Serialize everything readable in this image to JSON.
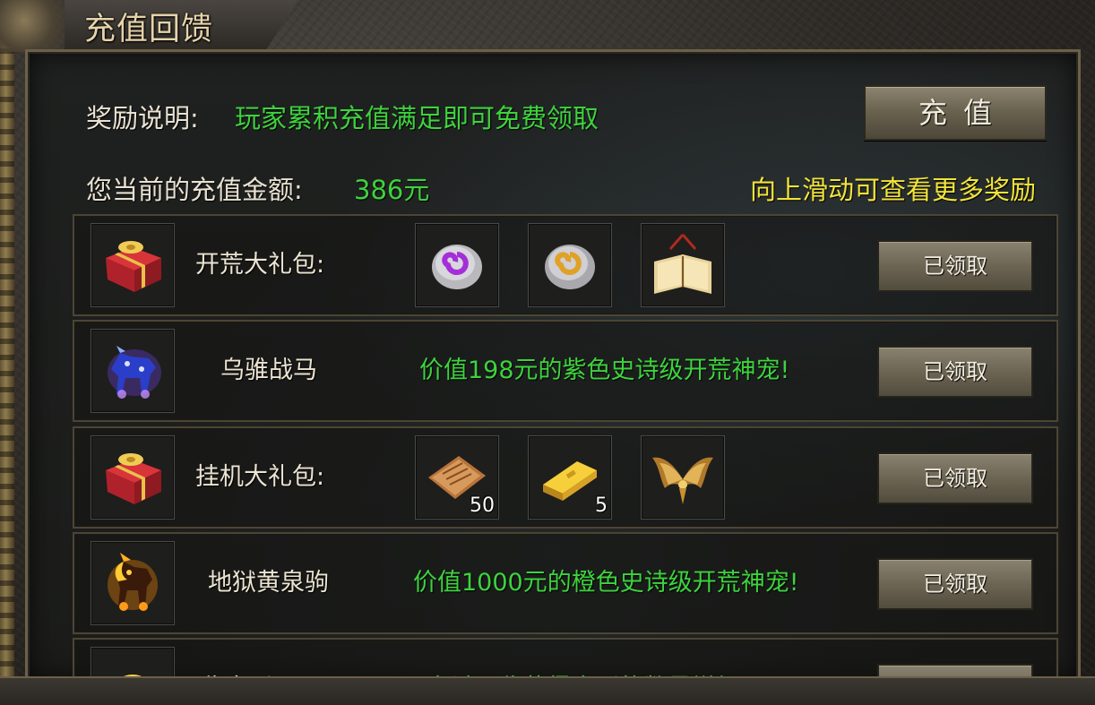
{
  "title": "充值回馈",
  "reward_desc": {
    "label": "奖励说明:",
    "text": "玩家累积充值满足即可免费领取"
  },
  "recharge_button": "充值",
  "current_amount": {
    "label": "您当前的充值金额:",
    "value": "386元"
  },
  "scroll_hint": "向上滑动可查看更多奖励",
  "rewards": [
    {
      "name": "开荒大礼包:",
      "type": "items",
      "status": "已领取",
      "items": [
        {
          "icon": "purple-rune-stone-icon",
          "qty": ""
        },
        {
          "icon": "gold-rune-stone-icon",
          "qty": ""
        },
        {
          "icon": "skill-book-icon",
          "qty": ""
        }
      ]
    },
    {
      "name": "乌骓战马",
      "type": "pet",
      "desc": "价值198元的紫色史诗级开荒神宠!",
      "status": "已领取"
    },
    {
      "name": "挂机大礼包:",
      "type": "items",
      "status": "已领取",
      "items": [
        {
          "icon": "scroll-icon",
          "qty": "50"
        },
        {
          "icon": "gold-bar-icon",
          "qty": "5"
        },
        {
          "icon": "golden-wings-icon",
          "qty": ""
        }
      ]
    },
    {
      "name": "地狱黄泉驹",
      "type": "pet",
      "desc": "价值1000元的橙色史诗级开荒神宠!",
      "status": "已领取"
    },
    {
      "name": "回收金币",
      "type": "pet",
      "desc": "击杀回收获得金币的数量增加",
      "status": ""
    }
  ],
  "colors": {
    "green_text": "#3ed23e",
    "yellow_hint": "#f2e43a",
    "title_gold": "#e6d3aa"
  }
}
